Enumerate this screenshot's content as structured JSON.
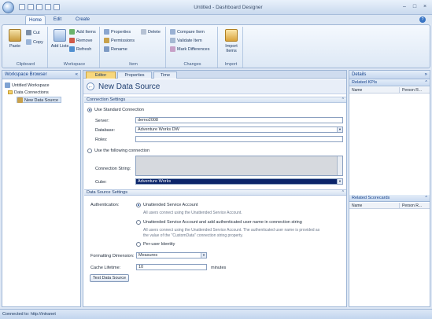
{
  "window": {
    "title": "Untitled - Dashboard Designer",
    "controls": [
      "–",
      "□",
      "×"
    ]
  },
  "ribbon": {
    "tabs": [
      "Home",
      "Edit",
      "Create"
    ],
    "groups": {
      "clipboard": {
        "label": "Clipboard",
        "paste": "Paste",
        "cut": "Cut",
        "copy": "Copy"
      },
      "workspace": {
        "label": "Workspace",
        "add_items": "Add Items",
        "add_lists": "Add Lists",
        "remove": "Remove",
        "refresh": "Refresh"
      },
      "item": {
        "label": "Item",
        "properties": "Properties",
        "permissions": "Permissions",
        "rename": "Rename",
        "delete": "Delete"
      },
      "changes": {
        "label": "Changes",
        "compare": "Compare Item",
        "validate": "Validate Item",
        "mark": "Mark Differences"
      },
      "import": {
        "label": "Import",
        "import_items": "Import Items"
      }
    }
  },
  "workspace_browser": {
    "title": "Workspace Browser",
    "tree": [
      "Untitled Workspace",
      "Data Connections",
      "New Data Source"
    ]
  },
  "editor": {
    "tabs": [
      "Editor",
      "Properties",
      "Time"
    ],
    "title": "New Data Source",
    "connection_settings": {
      "header": "Connection Settings",
      "standard_label": "Use Standard Connection",
      "server_label": "Server:",
      "server_value": "demo2008",
      "database_label": "Database:",
      "database_value": "Adventure Works DW",
      "roles_label": "Roles:",
      "roles_value": "",
      "custom_label": "Use the following connection",
      "conn_string_label": "Connection String:",
      "cube_label": "Cube:",
      "cube_value": "Adventure Works"
    },
    "source_settings": {
      "header": "Data Source Settings",
      "auth_label": "Authentication:",
      "opt1": "Unattended Service Account",
      "opt1_desc": "All users connect using the Unattended Service Account.",
      "opt2": "Unattended Service Account and add authenticated user name in connection string",
      "opt2_desc_1": "All users connect using the Unattended Service Account. The authenticated user name is provided as",
      "opt2_desc_2": "the value of the \"CustomData\" connection string property.",
      "opt3": "Per-user Identity",
      "format_label": "Formatting Dimension:",
      "format_value": "Measures",
      "cache_label": "Cache Lifetime:",
      "cache_value": "10",
      "cache_unit": "minutes",
      "test_button": "Test Data Source"
    }
  },
  "details": {
    "title": "Details",
    "related_kpis": "Related KPIs",
    "related_scorecards": "Related Scorecards",
    "col_name": "Name",
    "col_person": "Person R..."
  },
  "status": {
    "text": "Connected to: http://intranet"
  },
  "colors": {
    "accent": "#15428b",
    "active_tab": "#f7d77d",
    "selection": "#0a246a"
  }
}
